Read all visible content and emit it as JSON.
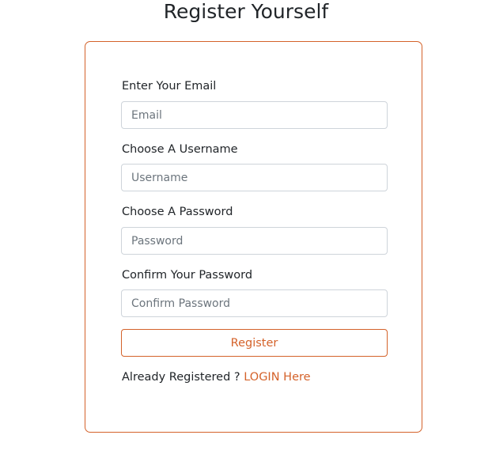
{
  "page": {
    "title": "Register Yourself"
  },
  "form": {
    "email": {
      "label": "Enter Your Email",
      "placeholder": "Email",
      "value": ""
    },
    "username": {
      "label": "Choose A Username",
      "placeholder": "Username",
      "value": ""
    },
    "password": {
      "label": "Choose A Password",
      "placeholder": "Password",
      "value": ""
    },
    "confirm_password": {
      "label": "Confirm Your Password",
      "placeholder": "Confirm Password",
      "value": ""
    },
    "register_label": "Register",
    "login_prompt": "Already Registered ?",
    "login_link": "LOGIN Here"
  },
  "colors": {
    "accent": "#d4622a",
    "input_border": "#ced4da",
    "text": "#212529"
  }
}
